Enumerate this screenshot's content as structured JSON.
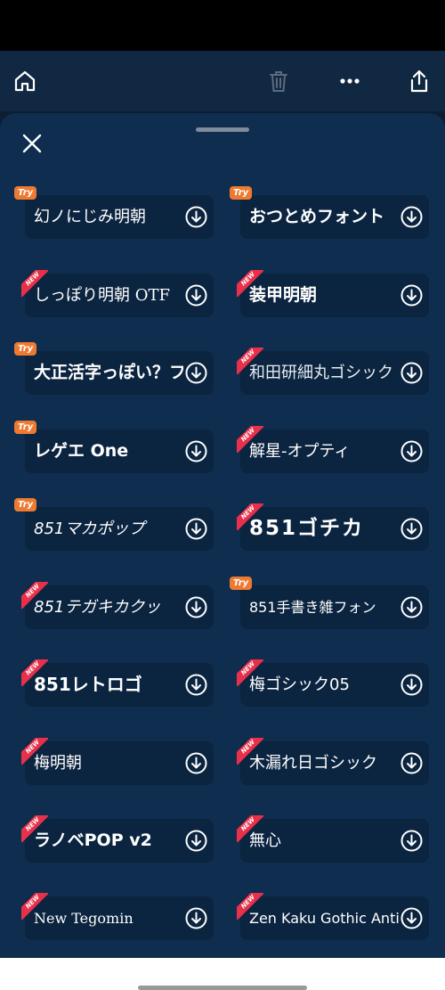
{
  "toolbar": {
    "home_icon": "home-icon",
    "trash_icon": "trash-icon",
    "more_icon": "more-horizontal-icon",
    "share_icon": "share-icon"
  },
  "sheet": {
    "close_icon": "close-icon"
  },
  "badges": {
    "try": "Try",
    "new": "NEW"
  },
  "fonts": [
    {
      "name": "幻ノにじみ明朝",
      "badge": "Try"
    },
    {
      "name": "おつとめフォント",
      "badge": "Try"
    },
    {
      "name": "しっぽり明朝 OTF",
      "badge": "NEW"
    },
    {
      "name": "装甲明朝",
      "badge": "NEW"
    },
    {
      "name": "大正活字っぽい？フ",
      "badge": "Try"
    },
    {
      "name": "和田研細丸ゴシック",
      "badge": "NEW"
    },
    {
      "name": "レゲエ One",
      "badge": "Try"
    },
    {
      "name": "解星-オプティ",
      "badge": "NEW"
    },
    {
      "name": "851マカポップ",
      "badge": "Try"
    },
    {
      "name": "851ゴチカ",
      "badge": "NEW"
    },
    {
      "name": "851テガキカクッ",
      "badge": "NEW"
    },
    {
      "name": "851手書き雑フォン",
      "badge": "Try"
    },
    {
      "name": "851レトロゴ",
      "badge": "NEW"
    },
    {
      "name": "梅ゴシック05",
      "badge": "NEW"
    },
    {
      "name": "梅明朝",
      "badge": "NEW"
    },
    {
      "name": "木漏れ日ゴシック",
      "badge": "NEW"
    },
    {
      "name": "ラノベPOP v2",
      "badge": "NEW"
    },
    {
      "name": "無心",
      "badge": "NEW"
    },
    {
      "name": "New Tegomin",
      "badge": "NEW"
    },
    {
      "name": "Zen Kaku Gothic Antique",
      "badge": "NEW"
    }
  ],
  "colors": {
    "toolbar_bg": "#102841",
    "sheet_bg": "#0f2d4e",
    "card_bg": "#0b2440",
    "try_badge": "#ee7a32",
    "new_badge": "#e8304a"
  }
}
